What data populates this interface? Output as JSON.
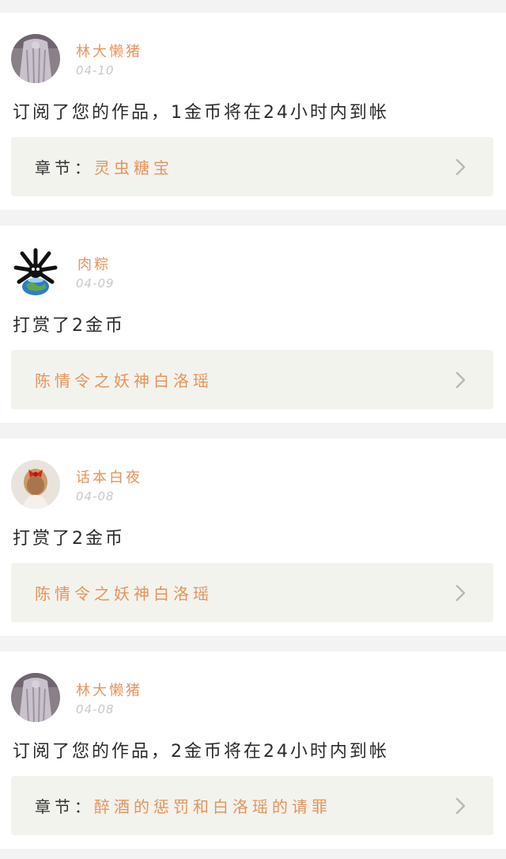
{
  "notifications": [
    {
      "username": "林大懒猪",
      "date": "04-10",
      "message": "订阅了您的作品，1金币将在24小时内到帐",
      "link_prefix": "章节：",
      "link_title": "灵虫糖宝",
      "avatar": "photo-gray-dress-icon"
    },
    {
      "username": "肉粽",
      "date": "04-09",
      "message": "打赏了2金币",
      "link_prefix": "",
      "link_title": "陈情令之妖神白洛瑶",
      "avatar": "cartoon-earth-icon"
    },
    {
      "username": "话本白夜",
      "date": "04-08",
      "message": "打赏了2金币",
      "link_prefix": "",
      "link_title": "陈情令之妖神白洛瑶",
      "avatar": "photo-girl-red-bow-icon"
    },
    {
      "username": "林大懒猪",
      "date": "04-08",
      "message": "订阅了您的作品，2金币将在24小时内到帐",
      "link_prefix": "章节：",
      "link_title": "醉酒的惩罚和白洛瑶的请罪",
      "avatar": "photo-gray-dress-icon"
    }
  ],
  "colors": {
    "accent": "#e8935a",
    "date_gray": "#c9c9c9",
    "link_box_bg": "#f3f3ee",
    "page_bg": "#f4f3f3"
  }
}
